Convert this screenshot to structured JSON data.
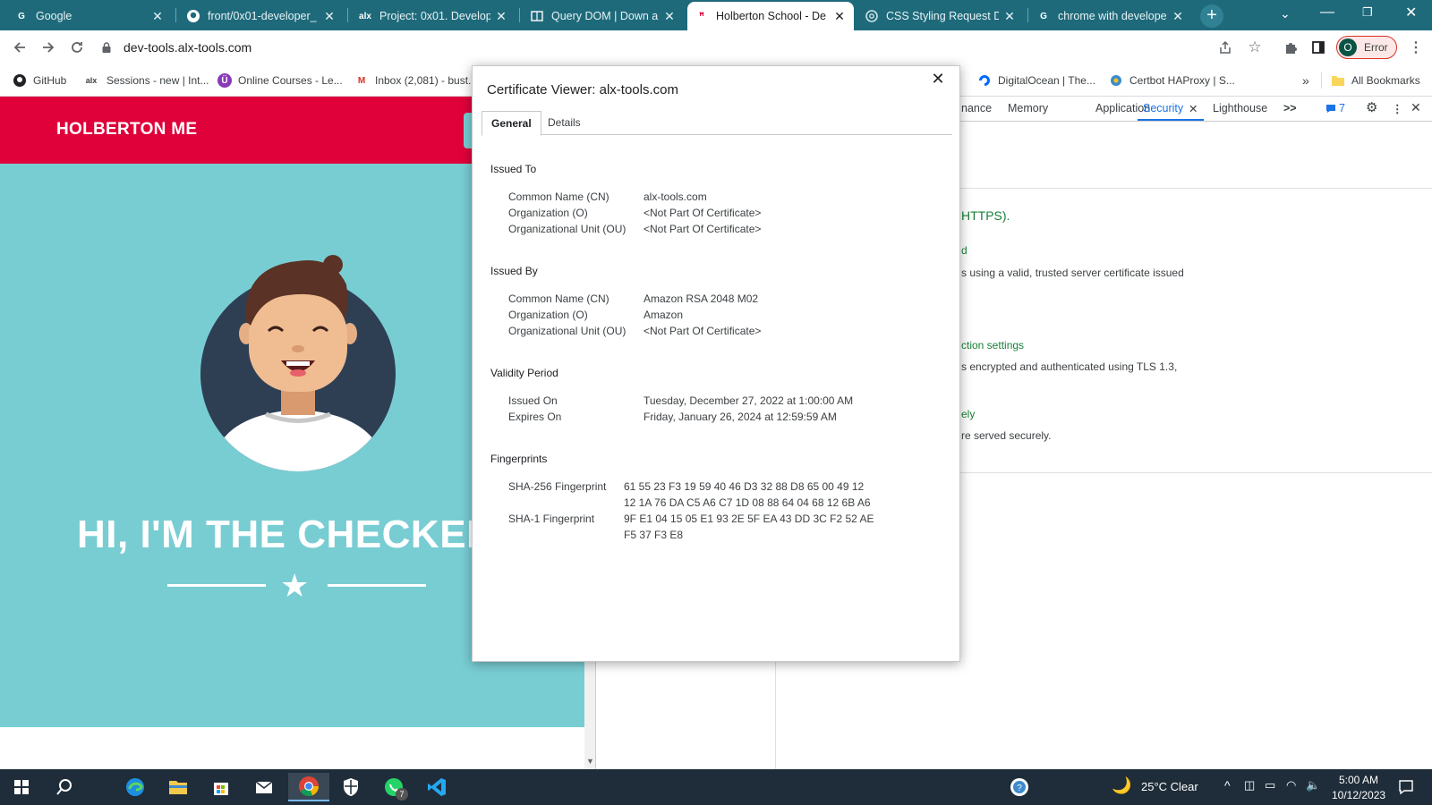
{
  "browser": {
    "tabs": [
      {
        "title": "Google",
        "icon": "google-icon",
        "active": false
      },
      {
        "title": "front/0x01-developer_",
        "icon": "github-icon",
        "active": false
      },
      {
        "title": "Project: 0x01. Develop",
        "icon": "alx-icon",
        "active": false
      },
      {
        "title": "Query DOM | Down an",
        "icon": "document-icon",
        "active": false
      },
      {
        "title": "Holberton School - De",
        "icon": "holberton-icon",
        "active": true
      },
      {
        "title": "CSS Styling Request D",
        "icon": "openai-icon",
        "active": false
      },
      {
        "title": "chrome with develope",
        "icon": "google-icon",
        "active": false
      }
    ],
    "url": "dev-tools.alx-tools.com",
    "profile": {
      "initial": "O",
      "status": "Error"
    },
    "bookmarks": [
      {
        "label": "GitHub",
        "icon": "github-icon"
      },
      {
        "label": "Sessions - new | Int...",
        "icon": "alx-icon"
      },
      {
        "label": "Online Courses - Le...",
        "icon": "udemy-icon"
      },
      {
        "label": "Inbox (2,081) - bust...",
        "icon": "gmail-icon"
      },
      {
        "label": "DigitalOcean | The...",
        "icon": "digitalocean-icon"
      },
      {
        "label": "Certbot HAProxy | S...",
        "icon": "certbot-icon"
      },
      {
        "label": "All Bookmarks",
        "icon": "folder-icon"
      }
    ],
    "bookmarks_overflow": "»"
  },
  "site": {
    "brand": "HOLBERTON ME",
    "hero_title": "HI, I'M THE CHECKER"
  },
  "devtools": {
    "tabs": [
      "nance",
      "Memory",
      "Application",
      "Security",
      "Lighthouse"
    ],
    "active_tab": "Security",
    "more": ">>",
    "issues_count": "7",
    "content": {
      "https_fragment": "HTTPS).",
      "cert_heading_fragment": "d",
      "cert_text": "s using a valid, trusted server certificate issued",
      "conn_heading_fragment": "ction settings",
      "conn_text": "s encrypted and authenticated using TLS 1.3,",
      "res_heading_fragment": "ely",
      "res_text": "re served securely."
    }
  },
  "certificate_dialog": {
    "title": "Certificate Viewer: alx-tools.com",
    "tabs": [
      "General",
      "Details"
    ],
    "active_tab": "General",
    "sections": [
      {
        "heading": "Issued To",
        "fields": [
          {
            "label": "Common Name (CN)",
            "value": "alx-tools.com"
          },
          {
            "label": "Organization (O)",
            "value": "<Not Part Of Certificate>"
          },
          {
            "label": "Organizational Unit (OU)",
            "value": "<Not Part Of Certificate>"
          }
        ]
      },
      {
        "heading": "Issued By",
        "fields": [
          {
            "label": "Common Name (CN)",
            "value": "Amazon RSA 2048 M02"
          },
          {
            "label": "Organization (O)",
            "value": "Amazon"
          },
          {
            "label": "Organizational Unit (OU)",
            "value": "<Not Part Of Certificate>"
          }
        ]
      },
      {
        "heading": "Validity Period",
        "fields": [
          {
            "label": "Issued On",
            "value": "Tuesday, December 27, 2022 at 1:00:00 AM"
          },
          {
            "label": "Expires On",
            "value": "Friday, January 26, 2024 at 12:59:59 AM"
          }
        ]
      },
      {
        "heading": "Fingerprints",
        "fields": [
          {
            "label": "SHA-256 Fingerprint",
            "value_lines": [
              "61 55 23 F3 19 59 40 46 D3 32 88 D8 65 00 49 12",
              "12 1A 76 DA C5 A6 C7 1D 08 88 64 04 68 12 6B A6"
            ]
          },
          {
            "label": "SHA-1 Fingerprint",
            "value_lines": [
              "9F E1 04 15 05 E1 93 2E 5F EA 43 DD 3C F2 52 AE",
              "F5 37 F3 E8"
            ]
          }
        ]
      }
    ]
  },
  "taskbar": {
    "weather": "25°C  Clear",
    "time": "5:00 AM",
    "date": "10/12/2023",
    "whatsapp_badge": "7"
  },
  "colors": {
    "tabstrip": "#1e6a7b",
    "site_header": "#e0003a",
    "hero": "#78cdd3",
    "taskbar": "#1f2d3a",
    "secure_green": "#188038",
    "devtools_accent": "#1a73e8"
  }
}
